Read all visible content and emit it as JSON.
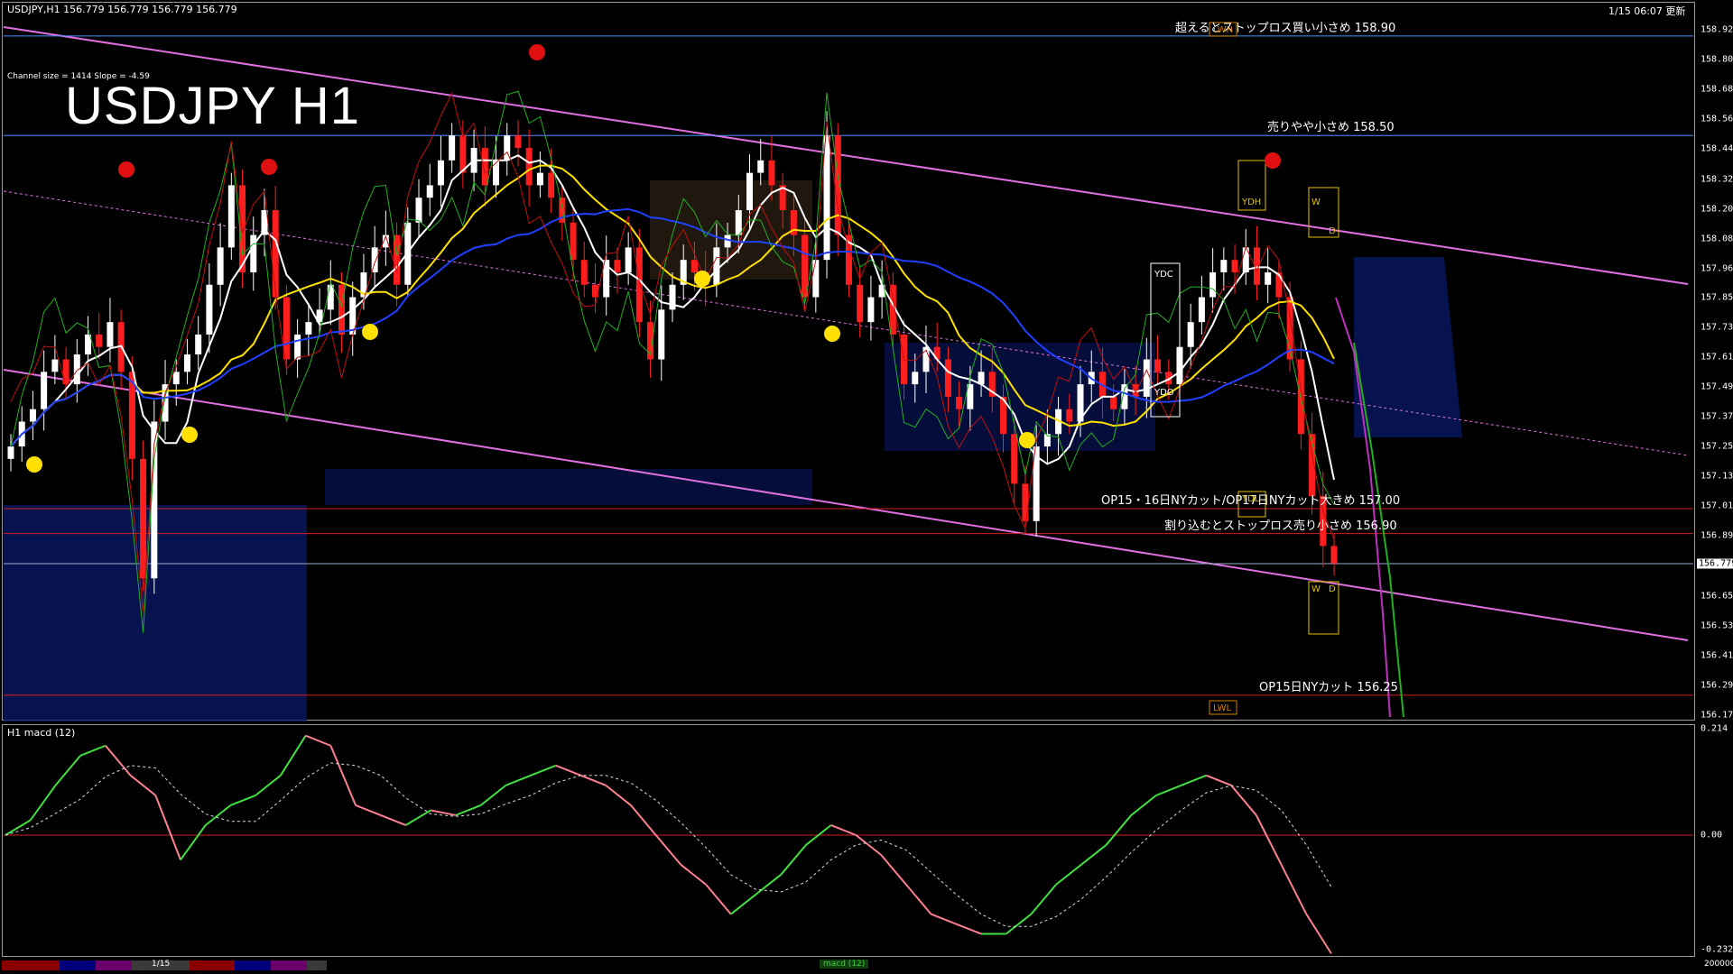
{
  "header": {
    "symbol_line": "USDJPY,H1  156.779 156.779 156.779 156.779",
    "time_text": "1/15 06:07 更新",
    "channel_text": "Channel size = 1414 Slope = -4.59",
    "big_title": "USDJPY H1"
  },
  "levels": [
    {
      "text": "超えるとストップロス買い小さめ 158.90",
      "price": 158.9,
      "color": "#4a8fff"
    },
    {
      "text": "売りやや小さめ 158.50",
      "price": 158.5,
      "color": "#4a8fff"
    },
    {
      "text": "OP15・16日NYカット/OP17日NYカット大きめ 157.00",
      "price": 157.0,
      "color": "#d02020"
    },
    {
      "text": "割り込むとストップロス売り小さめ 156.90",
      "price": 156.9,
      "color": "#d02020"
    },
    {
      "text": "OP15日NYカット 156.25",
      "price": 156.25,
      "color": "#d02020"
    }
  ],
  "price_axis": {
    "ticks": [
      "158.925",
      "158.805",
      "158.685",
      "158.565",
      "158.445",
      "158.325",
      "158.205",
      "158.085",
      "157.965",
      "157.850",
      "157.730",
      "157.610",
      "157.490",
      "157.370",
      "157.250",
      "157.130",
      "157.010",
      "156.890",
      "156.770",
      "156.650",
      "156.530",
      "156.410",
      "156.290",
      "156.170"
    ],
    "current": "156.779"
  },
  "box_labels": {
    "lwh": "LWH",
    "ydh": "YDH",
    "ydc": "YDC",
    "ydo": "YDO",
    "ydl": "YDL",
    "lwl": "LWL",
    "w": "W",
    "d": "D"
  },
  "macd": {
    "title": "H1  macd (12)",
    "axis": [
      "0.214",
      "0.00",
      "-0.232"
    ]
  },
  "bottom": {
    "date_label": "1/15",
    "panel_label": "macd (12)",
    "value": "200000"
  },
  "chart_data": {
    "type": "candlestick",
    "title": "USDJPY H1",
    "ylim": [
      156.17,
      158.95
    ],
    "grid": false,
    "closes": [
      157.25,
      157.35,
      157.4,
      157.55,
      157.6,
      157.5,
      157.62,
      157.7,
      157.65,
      157.75,
      157.55,
      157.2,
      156.72,
      157.35,
      157.5,
      157.55,
      157.62,
      157.7,
      157.9,
      158.05,
      158.3,
      157.95,
      158.1,
      158.2,
      157.85,
      157.6,
      157.7,
      157.75,
      157.8,
      157.9,
      157.7,
      157.85,
      157.95,
      158.05,
      158.1,
      157.9,
      158.15,
      158.25,
      158.3,
      158.4,
      158.5,
      158.35,
      158.45,
      158.3,
      158.4,
      158.5,
      158.45,
      158.3,
      158.35,
      158.25,
      158.15,
      158.0,
      157.9,
      157.85,
      158.0,
      157.95,
      158.05,
      157.75,
      157.6,
      157.8,
      157.9,
      158.0,
      157.95,
      157.9,
      158.05,
      158.1,
      158.2,
      158.35,
      158.4,
      158.3,
      158.2,
      158.1,
      157.85,
      158.0,
      158.5,
      158.1,
      157.9,
      157.75,
      157.85,
      157.9,
      157.7,
      157.5,
      157.55,
      157.65,
      157.6,
      157.45,
      157.4,
      157.5,
      157.55,
      157.45,
      157.3,
      157.1,
      156.95,
      157.25,
      157.3,
      157.4,
      157.35,
      157.5,
      157.55,
      157.45,
      157.4,
      157.5,
      157.45,
      157.6,
      157.55,
      157.5,
      157.65,
      157.75,
      157.85,
      157.95,
      158.0,
      157.95,
      158.05,
      157.9,
      157.95,
      157.85,
      157.6,
      157.3,
      157.05,
      156.85,
      156.78
    ]
  }
}
